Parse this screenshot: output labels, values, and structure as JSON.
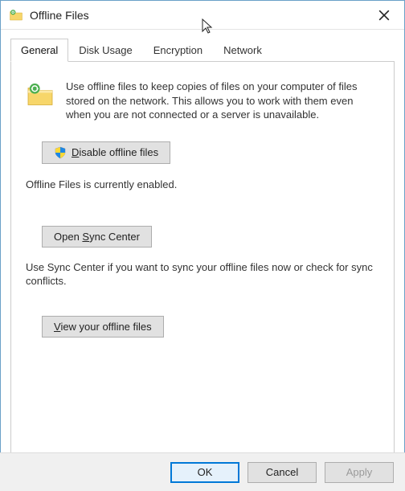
{
  "window": {
    "title": "Offline Files"
  },
  "tabs": {
    "general": "General",
    "disk_usage": "Disk Usage",
    "encryption": "Encryption",
    "network": "Network"
  },
  "general": {
    "intro": "Use offline files to keep copies of files on your computer of files stored on the network.  This allows you to work with them even when you are not connected or a server is unavailable.",
    "disable_prefix": "D",
    "disable_rest": "isable offline files",
    "status": "Offline Files is currently enabled.",
    "sync_prefix": "Open ",
    "sync_ul": "S",
    "sync_rest": "ync Center",
    "sync_help": "Use Sync Center if you want to sync your offline files now or check for sync conflicts.",
    "view_ul": "V",
    "view_rest": "iew your offline files"
  },
  "footer": {
    "ok": "OK",
    "cancel": "Cancel",
    "apply": "Apply"
  }
}
